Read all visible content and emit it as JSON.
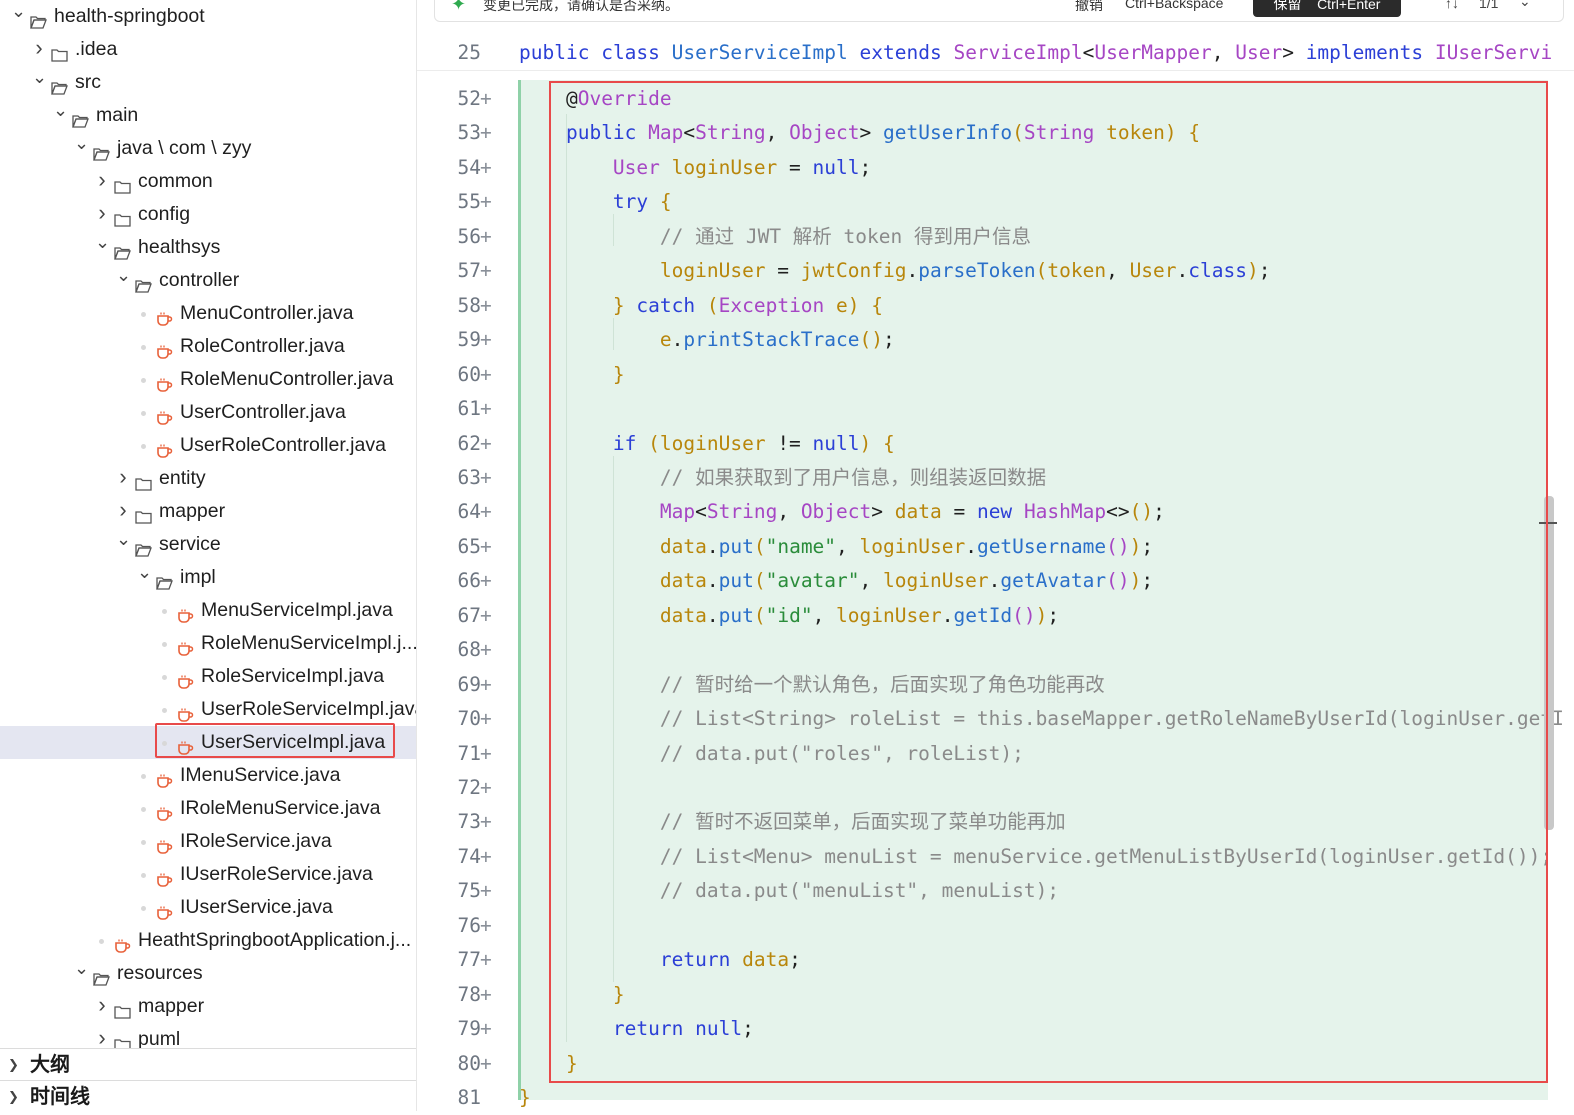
{
  "notification": {
    "message": "变更已完成，请确认是否采纳。",
    "undo_label": "撤销",
    "undo_shortcut": "Ctrl+Backspace",
    "keep_label": "保留",
    "keep_shortcut": "Ctrl+Enter",
    "nav_label": "↑↓",
    "change_count": "1/1",
    "more_label": "⌄"
  },
  "explorer": {
    "items": [
      {
        "label": "health-springboot",
        "type": "folder",
        "depth": 0,
        "expanded": true
      },
      {
        "label": ".idea",
        "type": "folder",
        "depth": 1,
        "expanded": false
      },
      {
        "label": "src",
        "type": "folder",
        "depth": 1,
        "expanded": true
      },
      {
        "label": "main",
        "type": "folder",
        "depth": 2,
        "expanded": true
      },
      {
        "label": "java \\ com \\ zyy",
        "type": "folder",
        "depth": 3,
        "expanded": true
      },
      {
        "label": "common",
        "type": "folder",
        "depth": 4,
        "expanded": false
      },
      {
        "label": "config",
        "type": "folder",
        "depth": 4,
        "expanded": false
      },
      {
        "label": "healthsys",
        "type": "folder",
        "depth": 4,
        "expanded": true
      },
      {
        "label": "controller",
        "type": "folder",
        "depth": 5,
        "expanded": true
      },
      {
        "label": "MenuController.java",
        "type": "java",
        "depth": 6
      },
      {
        "label": "RoleController.java",
        "type": "java",
        "depth": 6
      },
      {
        "label": "RoleMenuController.java",
        "type": "java",
        "depth": 6
      },
      {
        "label": "UserController.java",
        "type": "java",
        "depth": 6
      },
      {
        "label": "UserRoleController.java",
        "type": "java",
        "depth": 6
      },
      {
        "label": "entity",
        "type": "folder",
        "depth": 5,
        "expanded": false
      },
      {
        "label": "mapper",
        "type": "folder",
        "depth": 5,
        "expanded": false
      },
      {
        "label": "service",
        "type": "folder",
        "depth": 5,
        "expanded": true
      },
      {
        "label": "impl",
        "type": "folder",
        "depth": 6,
        "expanded": true
      },
      {
        "label": "MenuServiceImpl.java",
        "type": "java",
        "depth": 7
      },
      {
        "label": "RoleMenuServiceImpl.j...",
        "type": "java",
        "depth": 7
      },
      {
        "label": "RoleServiceImpl.java",
        "type": "java",
        "depth": 7
      },
      {
        "label": "UserRoleServiceImpl.java",
        "type": "java",
        "depth": 7
      },
      {
        "label": "UserServiceImpl.java",
        "type": "java",
        "depth": 7,
        "selected": true
      },
      {
        "label": "IMenuService.java",
        "type": "java",
        "depth": 6
      },
      {
        "label": "IRoleMenuService.java",
        "type": "java",
        "depth": 6
      },
      {
        "label": "IRoleService.java",
        "type": "java",
        "depth": 6
      },
      {
        "label": "IUserRoleService.java",
        "type": "java",
        "depth": 6
      },
      {
        "label": "IUserService.java",
        "type": "java",
        "depth": 6
      },
      {
        "label": "HeathtSpringbootApplication.j...",
        "type": "java",
        "depth": 4
      },
      {
        "label": "resources",
        "type": "folder",
        "depth": 3,
        "expanded": true
      },
      {
        "label": "mapper",
        "type": "folder",
        "depth": 4,
        "expanded": false
      },
      {
        "label": "puml",
        "type": "folder",
        "depth": 4,
        "expanded": false
      }
    ],
    "outline_label": "大纲",
    "timeline_label": "时间线"
  },
  "editor": {
    "sticky_line": {
      "number": "25",
      "marker": "",
      "text": "public class UserServiceImpl extends ServiceImpl<UserMapper, User> implements IUserServi"
    },
    "lines": [
      {
        "number": "52",
        "marker": "+",
        "text": "    @Override"
      },
      {
        "number": "53",
        "marker": "+",
        "text": "    public Map<String, Object> getUserInfo(String token) {"
      },
      {
        "number": "54",
        "marker": "+",
        "text": "        User loginUser = null;"
      },
      {
        "number": "55",
        "marker": "+",
        "text": "        try {"
      },
      {
        "number": "56",
        "marker": "+",
        "text": "            // 通过 JWT 解析 token 得到用户信息"
      },
      {
        "number": "57",
        "marker": "+",
        "text": "            loginUser = jwtConfig.parseToken(token, User.class);"
      },
      {
        "number": "58",
        "marker": "+",
        "text": "        } catch (Exception e) {"
      },
      {
        "number": "59",
        "marker": "+",
        "text": "            e.printStackTrace();"
      },
      {
        "number": "60",
        "marker": "+",
        "text": "        }"
      },
      {
        "number": "61",
        "marker": "+",
        "text": ""
      },
      {
        "number": "62",
        "marker": "+",
        "text": "        if (loginUser != null) {"
      },
      {
        "number": "63",
        "marker": "+",
        "text": "            // 如果获取到了用户信息，则组装返回数据"
      },
      {
        "number": "64",
        "marker": "+",
        "text": "            Map<String, Object> data = new HashMap<>();"
      },
      {
        "number": "65",
        "marker": "+",
        "text": "            data.put(\"name\", loginUser.getUsername());"
      },
      {
        "number": "66",
        "marker": "+",
        "text": "            data.put(\"avatar\", loginUser.getAvatar());"
      },
      {
        "number": "67",
        "marker": "+",
        "text": "            data.put(\"id\", loginUser.getId());"
      },
      {
        "number": "68",
        "marker": "+",
        "text": ""
      },
      {
        "number": "69",
        "marker": "+",
        "text": "            // 暂时给一个默认角色，后面实现了角色功能再改"
      },
      {
        "number": "70",
        "marker": "+",
        "text": "            // List<String> roleList = this.baseMapper.getRoleNameByUserId(loginUser.getI"
      },
      {
        "number": "71",
        "marker": "+",
        "text": "            // data.put(\"roles\", roleList);"
      },
      {
        "number": "72",
        "marker": "+",
        "text": ""
      },
      {
        "number": "73",
        "marker": "+",
        "text": "            // 暂时不返回菜单，后面实现了菜单功能再加"
      },
      {
        "number": "74",
        "marker": "+",
        "text": "            // List<Menu> menuList = menuService.getMenuListByUserId(loginUser.getId());"
      },
      {
        "number": "75",
        "marker": "+",
        "text": "            // data.put(\"menuList\", menuList);"
      },
      {
        "number": "76",
        "marker": "+",
        "text": ""
      },
      {
        "number": "77",
        "marker": "+",
        "text": "            return data;"
      },
      {
        "number": "78",
        "marker": "+",
        "text": "        }"
      },
      {
        "number": "79",
        "marker": "+",
        "text": "        return null;"
      },
      {
        "number": "80",
        "marker": "+",
        "text": "    }"
      },
      {
        "number": "81",
        "marker": "",
        "text": "}"
      }
    ]
  },
  "colors": {
    "accent_red": "#e84a4a",
    "diff_added_bg": "#e5f3eb",
    "selection_bg": "#e4e6f1",
    "java_icon": "#e8613a"
  }
}
